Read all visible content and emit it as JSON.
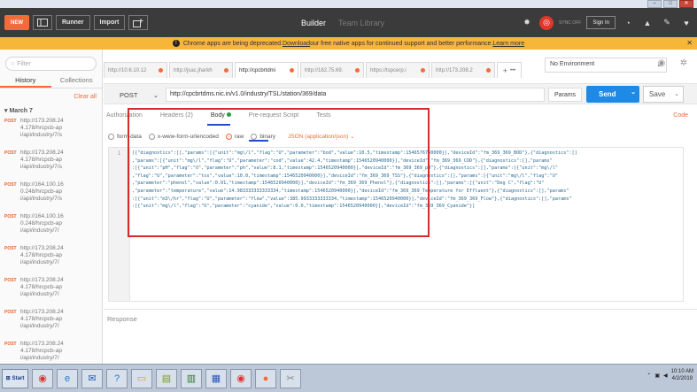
{
  "window": {
    "minimize": "–",
    "maximize": "□",
    "close": "✕"
  },
  "header": {
    "new_label": "NEW",
    "runner_label": "Runner",
    "import_label": "Import",
    "builder_label": "Builder",
    "team_library_label": "Team Library",
    "sync_label": "SYNC OFF",
    "signin_label": "Sign In"
  },
  "banner": {
    "text_before": "Chrome apps are being deprecated. ",
    "link1": "Download",
    "text_middle": " our free native apps for continued support and better performance. ",
    "link2": "Learn more"
  },
  "sidebar": {
    "filter_placeholder": "Filter",
    "tab_history": "History",
    "tab_collections": "Collections",
    "clear_all": "Clear all",
    "date_group": "March 7",
    "items": [
      {
        "method": "POST",
        "url": "http://173.208.24\n4.178/hrcpcb-ap\ni/api/industry/7/s"
      },
      {
        "method": "POST",
        "url": "http://173.208.24\n4.178/hrcpcb-ap\ni/api/industry/7/s"
      },
      {
        "method": "POST",
        "url": "http://164.100.16\n0.248/hrcpcb-ap\ni/api/industry/7/s"
      },
      {
        "method": "POST",
        "url": "http://164.100.16\n0.248/hrcpcb-ap\ni/api/industry/7/"
      },
      {
        "method": "POST",
        "url": "http://173.208.24\n4.178/hrcpcb-ap\ni/api/industry/7/"
      },
      {
        "method": "POST",
        "url": "http://173.208.24\n4.178/hrcpcb-ap\ni/api/industry/7/"
      },
      {
        "method": "POST",
        "url": "http://173.208.24\n4.178/hrcpcb-ap\ni/api/industry/7/"
      },
      {
        "method": "POST",
        "url": "http://173.208.24\n4.178/hrcpcb-ap\ni/api/industry/7/"
      }
    ]
  },
  "tabs": [
    {
      "label": "http://10.6.10.12"
    },
    {
      "label": "http://jsac.jharkh"
    },
    {
      "label": "http://cpcbrtdmi"
    },
    {
      "label": "http://182.75.69."
    },
    {
      "label": "https://tspcerp.i"
    },
    {
      "label": "http://173.208.2"
    }
  ],
  "environment": {
    "selected": "No Environment"
  },
  "request": {
    "method": "POST",
    "url": "http://cpcbrtdms.nic.in/v1.0/industry/TSL/station/369/data",
    "params_label": "Params",
    "send_label": "Send",
    "save_label": "Save"
  },
  "options": {
    "authorization": "Authorization",
    "headers": "Headers (2)",
    "body": "Body",
    "prerequest": "Pre-request Script",
    "tests": "Tests",
    "code": "Code"
  },
  "body_modes": {
    "formdata": "form-data",
    "urlencoded": "x-www-form-urlencoded",
    "raw": "raw",
    "binary": "binary",
    "content_type": "JSON (application/json)"
  },
  "editor": {
    "line_number": "1",
    "content": "[{\"diagnostics\":[],\"params\":[{\"unit\":\"mg\\/l\",\"flag\":\"U\",\"parameter\":\"bod\",\"value\":10.5,\"timestamp\":1546576760000}],\"deviceId\":\"fm_369_369_BOD\"},{\"diagnostics\":[]\n,\"params\":[{\"unit\":\"mg\\/l\",\"flag\":\"U\",\"parameter\":\"cod\",\"value\":42.4,\"timestamp\":1546520940000}],\"deviceId\":\"fm_369_369_COD\"},{\"diagnostics\":[],\"params\"\n:[{\"unit\":\"pH\",\"flag\":\"U\",\"parameter\":\"ph\",\"value\":8.1,\"timestamp\":1546520940000}],\"deviceId\":\"fm_369_369_pH\"},{\"diagnostics\":[],\"params\":[{\"unit\":\"mg\\/l\"\n,\"flag\":\"U\",\"parameter\":\"tss\",\"value\":10.0,\"timestamp\":1546520940000}],\"deviceId\":\"fm_369_369_TSS\"},{\"diagnostics\":[],\"params\":[{\"unit\":\"mg\\/l\",\"flag\":\"U\"\n,\"parameter\":\"phenol\",\"value\":0.01,\"timestamp\":1546520940000}],\"deviceId\":\"fm_369_369_Phenol\"},{\"diagnostics\":[],\"params\":[{\"unit\":\"Deg C\",\"flag\":\"U\"\n,\"parameter\":\"temperature\",\"value\":14.983333333333334,\"timestamp\":1546520940000}],\"deviceId\":\"fm_369_369_Temperature for Effluent\"},{\"diagnostics\":[],\"params\"\n:[{\"unit\":\"m3\\/hr\",\"flag\":\"U\",\"parameter\":\"flow\",\"value\":385.9933333333334,\"timestamp\":1546520940000}],\"deviceId\":\"fm_369_369_Flow\"},{\"diagnostics\":[],\"params\"\n:[{\"unit\":\"mg\\/l\",\"flag\":\"U\",\"parameter\":\"cyanide\",\"value\":0.0,\"timestamp\":1546520940000}],\"deviceId\":\"fm_369_369_Cyanide\"}]"
  },
  "response": {
    "label": "Response"
  },
  "taskbar": {
    "start_label": "Start",
    "time": "10:10 AM",
    "date": "4/2/2019"
  }
}
